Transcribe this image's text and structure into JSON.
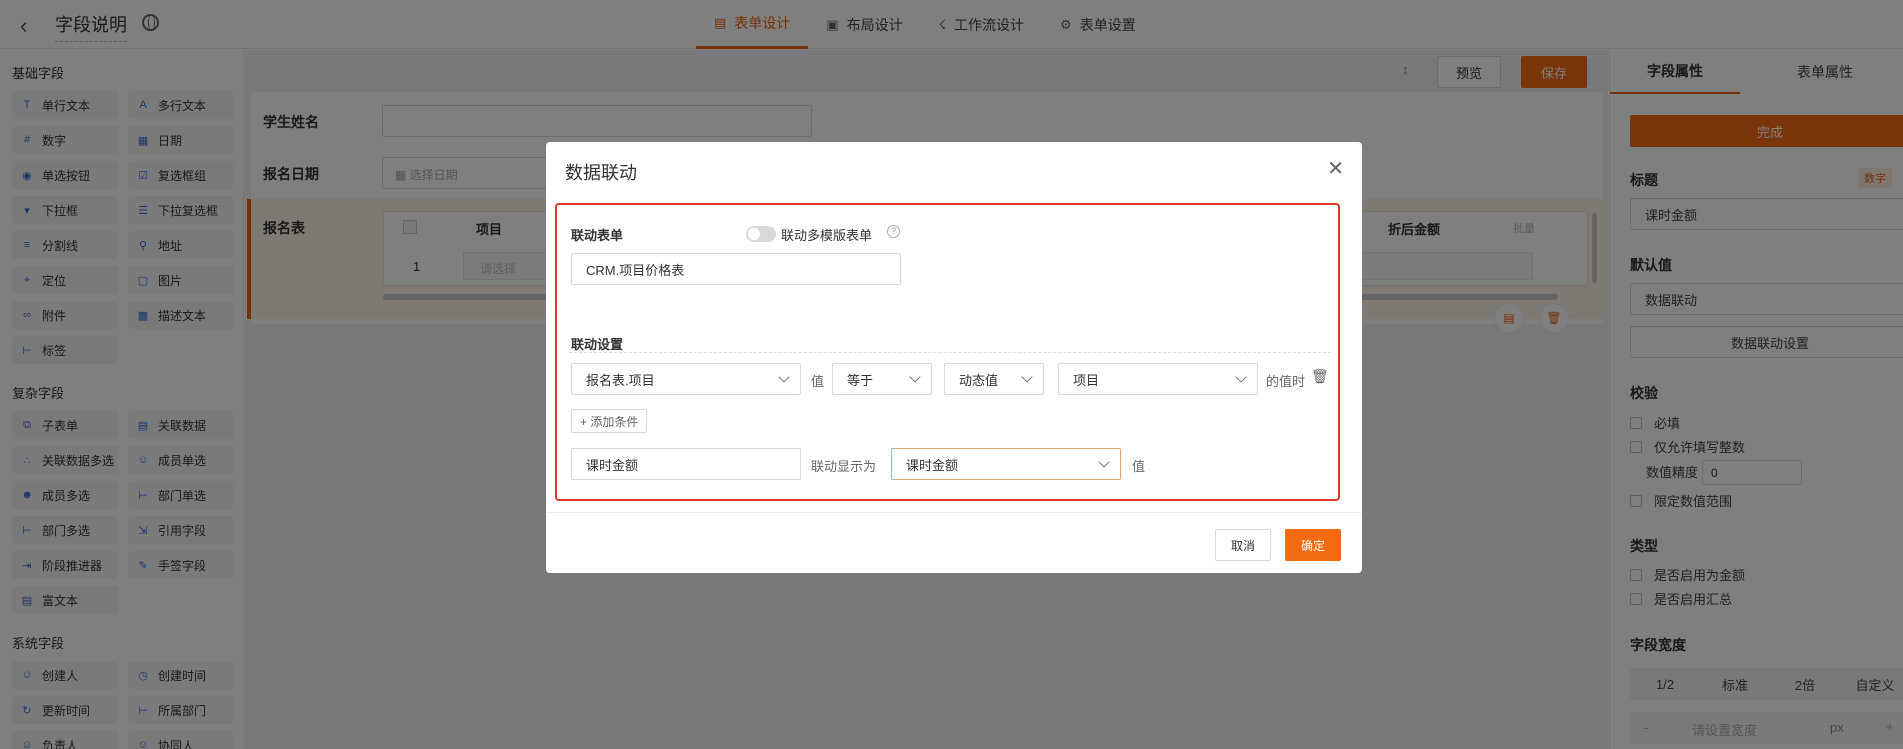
{
  "header": {
    "back_icon": "chevron-left-icon",
    "title": "字段说明",
    "tabs": [
      {
        "label": "表单设计",
        "icon": "form-icon",
        "active": true
      },
      {
        "label": "布局设计",
        "icon": "layout-icon",
        "active": false
      },
      {
        "label": "工作流设计",
        "icon": "workflow-icon",
        "active": false
      },
      {
        "label": "表单设置",
        "icon": "gear-icon",
        "active": false
      }
    ]
  },
  "sidebar": {
    "basic_title": "基础字段",
    "basic": [
      "单行文本",
      "多行文本",
      "数字",
      "日期",
      "单选按钮",
      "复选框组",
      "下拉框",
      "下拉复选框",
      "分割线",
      "地址",
      "定位",
      "图片",
      "附件",
      "描述文本",
      "标签"
    ],
    "complex_title": "复杂字段",
    "complex": [
      "子表单",
      "关联数据",
      "关联数据多选",
      "成员单选",
      "成员多选",
      "部门单选",
      "部门多选",
      "引用字段",
      "阶段推进器",
      "手签字段",
      "富文本"
    ],
    "system_title": "系统字段",
    "system": [
      "创建人",
      "创建时间",
      "更新时间",
      "所属部门",
      "负责人",
      "协同人"
    ]
  },
  "canvas": {
    "preview_label": "预览",
    "save_label": "保存",
    "fields": {
      "student_name": "学生姓名",
      "signup_date": "报名日期",
      "date_placeholder": "选择日期",
      "signup_table": "报名表",
      "col_project": "项目",
      "col_discounted": "折后金额",
      "batch_label": "批量",
      "row_no": "1",
      "select_placeholder": "请选择"
    }
  },
  "right_panel": {
    "tab_field": "字段属性",
    "tab_form": "表单属性",
    "done_label": "完成",
    "title_label": "标题",
    "type_badge": "数字",
    "title_value": "课时金额",
    "default_label": "默认值",
    "default_value": "数据联动",
    "linkage_btn": "数据联动设置",
    "validate_label": "校验",
    "required": "必填",
    "integer_only": "仅允许填写整数",
    "precision_label": "数值精度",
    "precision_value": "0",
    "limit_range": "限定数值范围",
    "type_label": "类型",
    "as_amount": "是否启用为金额",
    "as_sum": "是否启用汇总",
    "width_label": "字段宽度",
    "width_options": [
      "1/2",
      "标准",
      "2倍",
      "自定义"
    ],
    "width_placeholder": "请设置宽度",
    "unit": "px"
  },
  "modal": {
    "title": "数据联动",
    "linked_form_label": "联动表单",
    "multi_template_label": "联动多模版表单",
    "linked_form_value": "CRM.项目价格表",
    "settings_label": "联动设置",
    "cond_field": "报名表.项目",
    "value_text": "值",
    "operator": "等于",
    "value_type": "动态值",
    "target_field": "项目",
    "when_text": "的值时",
    "add_condition": "+ 添加条件",
    "display_source": "课时金额",
    "display_as_text": "联动显示为",
    "display_target": "课时金额",
    "value_suffix": "值",
    "cancel_label": "取消",
    "ok_label": "确定"
  }
}
